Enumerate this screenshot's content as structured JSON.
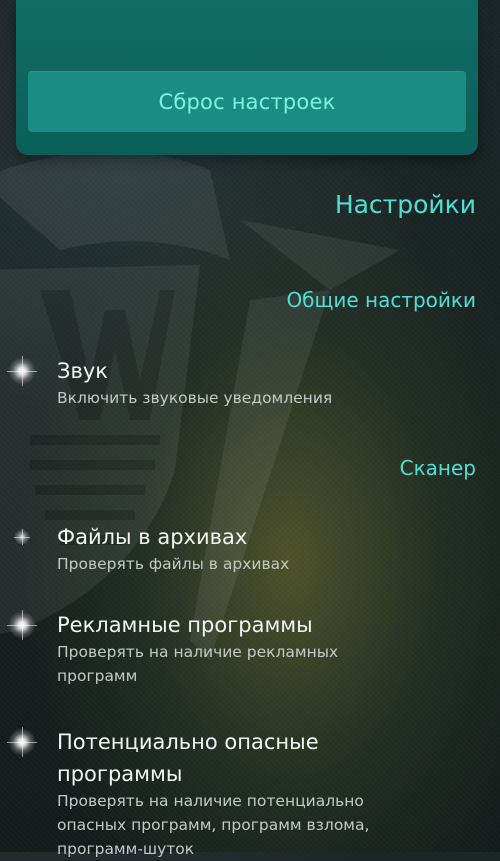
{
  "reset": {
    "label": "Сброс настроек"
  },
  "page": {
    "title": "Настройки"
  },
  "sections": [
    {
      "header": "Общие настройки"
    },
    {
      "header": "Сканер"
    }
  ],
  "settings": [
    {
      "title": "Звук",
      "desc": "Включить звуковые уведомления",
      "enabled": true
    },
    {
      "title": "Файлы в архивах",
      "desc": "Проверять файлы в архивах",
      "enabled": false
    },
    {
      "title": "Рекламные программы",
      "desc": "Проверять на наличие рекламных программ",
      "enabled": true
    },
    {
      "title": "Потенциально опасные программы",
      "desc": "Проверять на наличие потенциально опасных программ, программ взлома, программ-шуток",
      "enabled": true
    }
  ],
  "colors": {
    "accent": "#4fe0d4",
    "card": "#0f6d66",
    "button": "#1a8c83",
    "button_text": "#7ff0e4"
  },
  "icons": {
    "toggle_on": "glow-star-icon",
    "toggle_off": "dim-star-icon"
  }
}
